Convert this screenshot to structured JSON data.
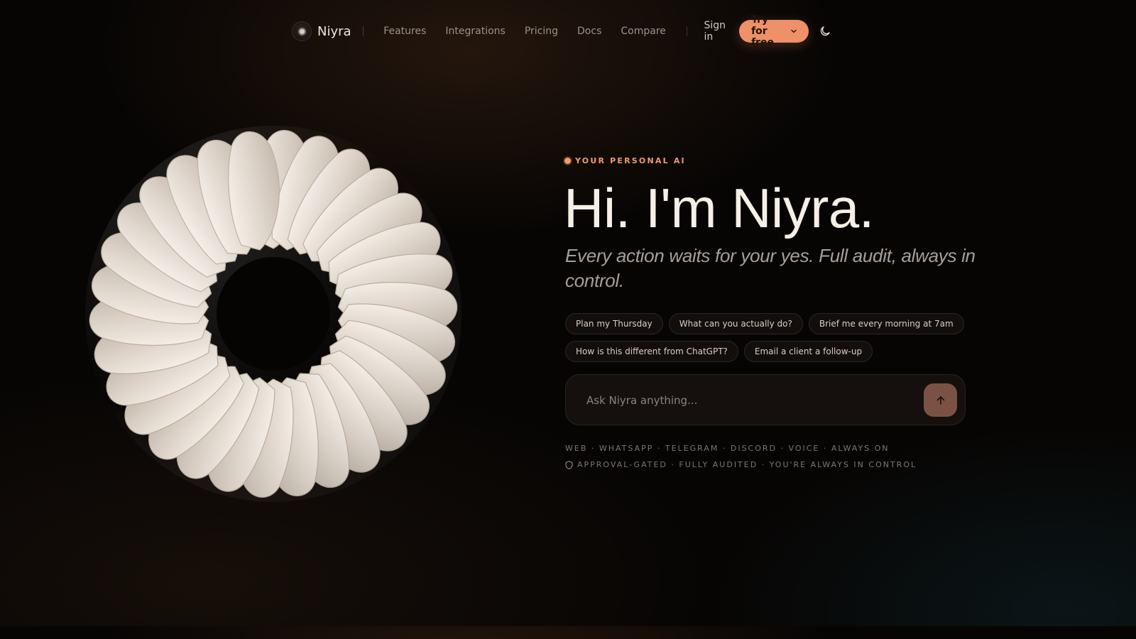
{
  "brand": {
    "name": "Niyra"
  },
  "nav": {
    "links": [
      "Features",
      "Integrations",
      "Pricing",
      "Docs",
      "Compare"
    ],
    "signin": "Sign in",
    "cta": "Try for free"
  },
  "hero": {
    "eyebrow": "YOUR PERSONAL AI",
    "title": "Hi. I'm Niyra.",
    "subtitle": "Every action waits for your yes. Full audit, always in control."
  },
  "suggestions": [
    "Plan my Thursday",
    "What can you actually do?",
    "Brief me every morning at 7am",
    "How is this different from ChatGPT?",
    "Email a client a follow-up"
  ],
  "ask": {
    "placeholder": "Ask Niyra anything..."
  },
  "footer": {
    "channels": "WEB · WHATSAPP · TELEGRAM · DISCORD · VOICE · ALWAYS ON",
    "trust": "APPROVAL-GATED · FULLY AUDITED · YOU'RE ALWAYS IN CONTROL"
  },
  "icons": {
    "logo": "niyra-logo-icon",
    "cta_chevron": "chevron-down-icon",
    "theme": "moon-icon",
    "eyebrow": "dot-icon",
    "send": "arrow-up-icon",
    "trust": "shield-icon"
  },
  "colors": {
    "accent": "#ee9168",
    "background": "#070504",
    "petal": "#dcd3c8",
    "send_button": "#7a5244"
  }
}
